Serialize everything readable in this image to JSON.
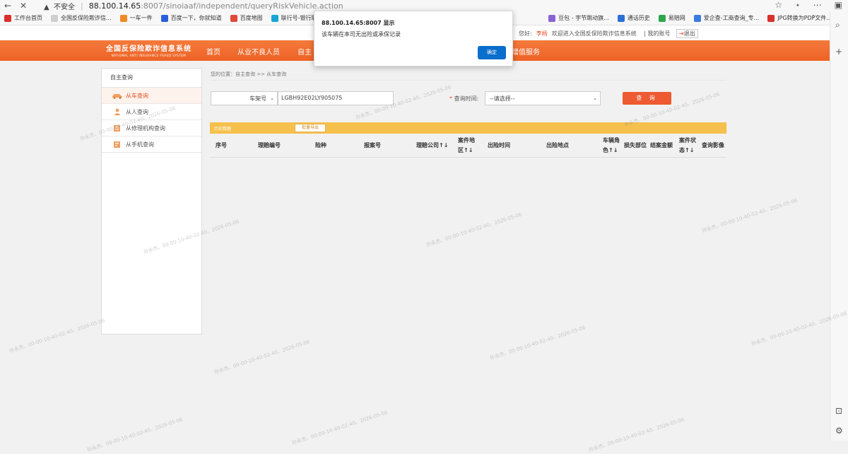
{
  "browser": {
    "security_label": "不安全",
    "url_host": "88.100.14.65",
    "url_path": ":8007/sinoiaaf/independent/queryRiskVehicle.action",
    "bookmarks": [
      {
        "label": "工作台首页",
        "color": "#d9302a"
      },
      {
        "label": "全国反保险欺诈信...",
        "color": "#cfcfcf"
      },
      {
        "label": "一车一件",
        "color": "#f08a24"
      },
      {
        "label": "百度一下，你就知道",
        "color": "#2b5fd9"
      },
      {
        "label": "百度地图",
        "color": "#e04a3a"
      },
      {
        "label": "联行号-银行联行号...",
        "color": "#1aa5d6"
      },
      {
        "label": "豆包 - 字节跳动旗...",
        "color": "#8a63d2"
      },
      {
        "label": "通话历史",
        "color": "#2b6fd9"
      },
      {
        "label": "易赔网",
        "color": "#2aa84a"
      },
      {
        "label": "爱企查-工商查询_专...",
        "color": "#3b7be0"
      },
      {
        "label": "JPG转换为PDF文件...",
        "color": "#d9302a"
      }
    ]
  },
  "header": {
    "greeting_prefix": "您好:",
    "user_name": "李杨",
    "welcome_text": "欢迎进入全国反保险欺诈信息系统",
    "my_account": "| 我的账号",
    "logout": "退出"
  },
  "nav": {
    "logo_cn": "全国反保险欺诈信息系统",
    "logo_en": "NATIONAL ANTI INSURANCE FRAUD SYSTEM",
    "items": [
      "首页",
      "从业不良人员",
      "自主",
      "增值服务"
    ]
  },
  "sidebar": {
    "title": "自主查询",
    "items": [
      {
        "label": "从车查询",
        "icon": "car-icon"
      },
      {
        "label": "从人查询",
        "icon": "person-icon"
      },
      {
        "label": "从修理机构查询",
        "icon": "repair-shop-icon"
      },
      {
        "label": "从手机查询",
        "icon": "phone-icon"
      }
    ]
  },
  "main": {
    "breadcrumb": "您的位置：自主查询 >> 从车查询",
    "field_type_selected": "车架号",
    "vin_value": "LGBH92E02LY905075",
    "query_time_label": "查询时间:",
    "query_time_selected": "--请选择--",
    "query_button": "查 询",
    "history_label": "历史数据",
    "export_button": "批量导出",
    "columns": [
      {
        "l1": "序号",
        "l2": ""
      },
      {
        "l1": "理赔编号",
        "l2": ""
      },
      {
        "l1": "险种",
        "l2": ""
      },
      {
        "l1": "报案号",
        "l2": ""
      },
      {
        "l1": "理赔公司↑↓",
        "l2": ""
      },
      {
        "l1": "案件地",
        "l2": "区↑↓"
      },
      {
        "l1": "出险时间",
        "l2": ""
      },
      {
        "l1": "出险地点",
        "l2": ""
      },
      {
        "l1": "车辆角",
        "l2": "色↑↓"
      },
      {
        "l1": "损失部位",
        "l2": ""
      },
      {
        "l1": "结案金额",
        "l2": ""
      },
      {
        "l1": "案件状",
        "l2": "态↑↓"
      },
      {
        "l1": "查询影像",
        "l2": ""
      }
    ]
  },
  "dialog": {
    "title": "88.100.14.65:8007 显示",
    "message": "该车辆在本司无出险或承保记录",
    "ok_label": "确定"
  },
  "watermark": "孙永杰、00-00-10-40-02-40、2026-05-06"
}
